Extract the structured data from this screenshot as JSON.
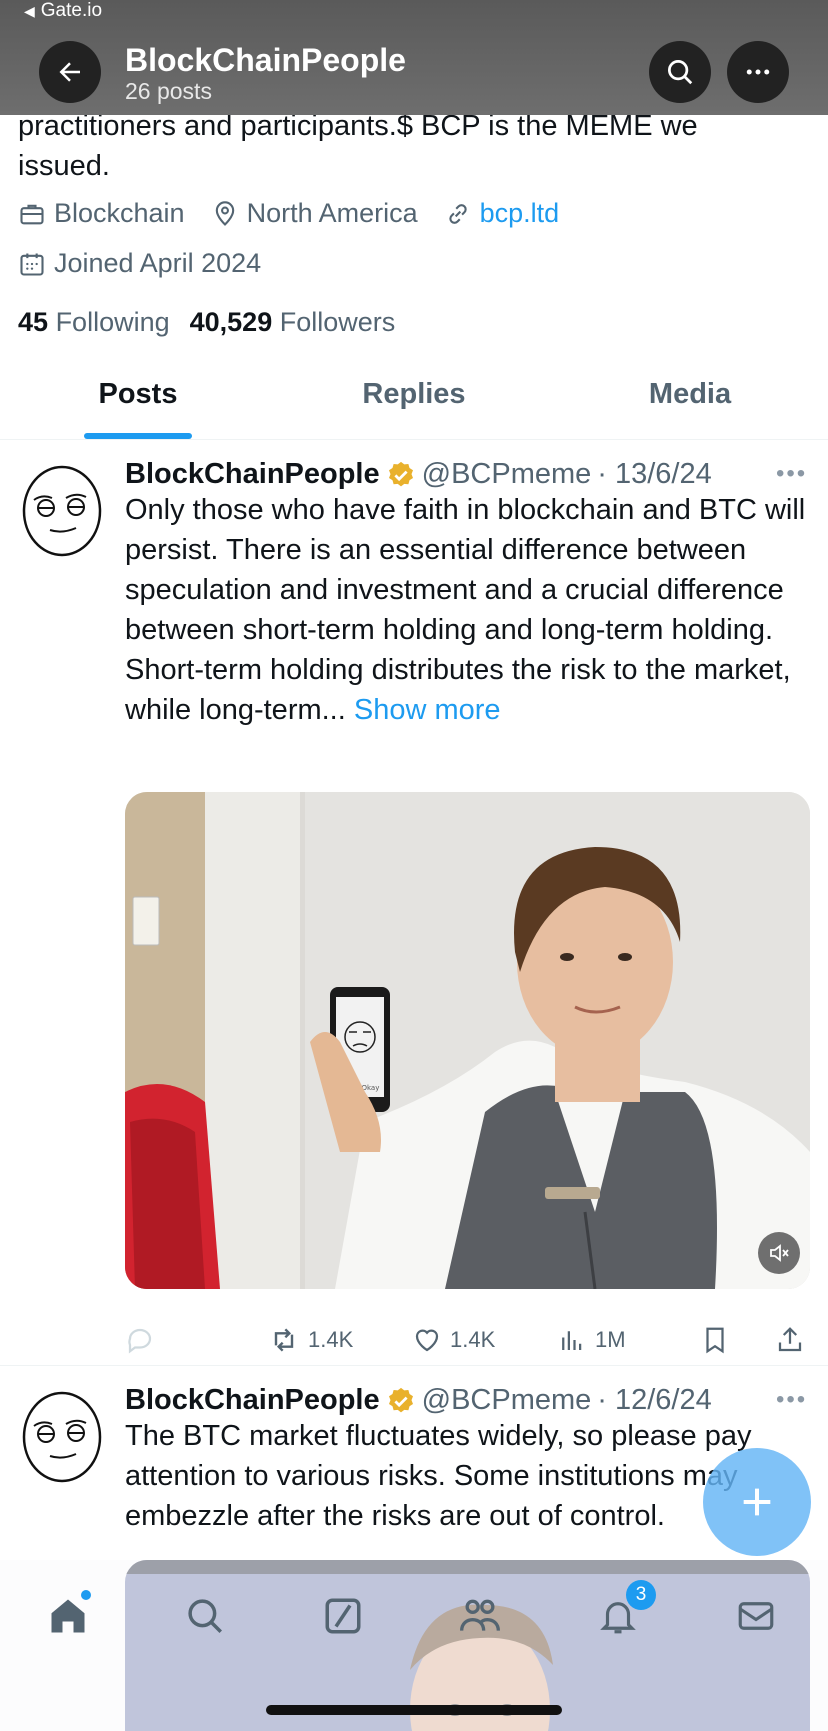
{
  "status_bar": {
    "back_app": "Gate.io"
  },
  "header": {
    "name": "BlockChainPeople",
    "post_count": "26 posts"
  },
  "profile": {
    "bio_tail_line1": "practitioners and participants.$ BCP is the MEME we",
    "bio_tail_line2": "issued.",
    "category": "Blockchain",
    "location": "North America",
    "website": "bcp.ltd",
    "joined": "Joined April 2024",
    "following_count": "45",
    "following_label": "Following",
    "followers_count": "40,529",
    "followers_label": "Followers"
  },
  "tabs": [
    {
      "label": "Posts",
      "active": true
    },
    {
      "label": "Replies",
      "active": false
    },
    {
      "label": "Media",
      "active": false
    }
  ],
  "posts": [
    {
      "name": "BlockChainPeople",
      "handle": "@BCPmeme",
      "date": "· 13/6/24",
      "text": "Only those who have faith in blockchain and BTC will persist. There is an essential difference between speculation and investment and a crucial difference between short-term holding and long-term holding. Short-term holding distributes the risk to the market, while long-term...",
      "show_more": "Show more",
      "media_caption": "Not Okay",
      "reposts": "1.4K",
      "likes": "1.4K",
      "views": "1M"
    },
    {
      "name": "BlockChainPeople",
      "handle": "@BCPmeme",
      "date": "· 12/6/24",
      "text": "The BTC market fluctuates widely, so please pay attention to various risks. Some institutions may embezzle after the risks are out of control."
    }
  ],
  "bottom_nav": {
    "notifications_badge": "3"
  },
  "colors": {
    "accent": "#1d9bf0",
    "verified": "#e9b12c",
    "text": "#0f1419",
    "muted": "#536471"
  }
}
